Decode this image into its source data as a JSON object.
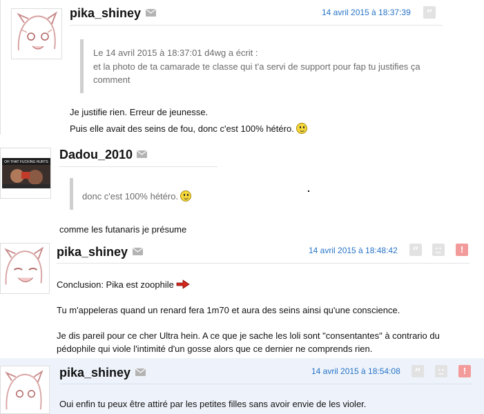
{
  "posts": [
    {
      "username": "pika_shiney",
      "date": "14 avril 2015 à 18:37:39",
      "quote_header": "Le 14 avril 2015 à 18:37:01 d4wg a écrit :",
      "quote_line1": "et la photo de ta camarade te classe qui t'a servi de support pour fap tu justifies ça",
      "quote_line2": "comment",
      "line1": "Je justifie rien. Erreur de jeunesse.",
      "line2": "Puis elle avait des seins de fou, donc c'est 100% hétéro."
    },
    {
      "username": "Dadou_2010",
      "avatar_text": "OH THAT FUCKING HURTS",
      "quote_text": "donc c'est 100% hétéro.",
      "line1": "comme les futanaris je présume"
    },
    {
      "username": "pika_shiney",
      "date": "14 avril 2015 à 18:48:42",
      "line1": "Conclusion: Pika est zoophile",
      "line2": "Tu m'appeleras quand un renard fera 1m70 et aura des seins ainsi qu'une conscience.",
      "line3": "Je dis pareil pour ce cher Ultra hein. A ce que je sache les loli sont \"consentantes\" à contrario du",
      "line4": "pédophile qui viole l'intimité d'un gosse alors que ce dernier ne comprends rien."
    },
    {
      "username": "pika_shiney",
      "date": "14 avril 2015 à 18:54:08",
      "line1": "Oui enfin tu peux être attiré par les petites filles sans avoir envie de les violer."
    }
  ],
  "icons": {
    "quote": "quote-icon",
    "mail": "mail-icon",
    "sad": "sad-face-icon",
    "alert": "alert-icon",
    "smiley": "smiley-icon",
    "arrow": "red-arrow-icon",
    "alert_glyph": "!",
    "quote_glyph": "”"
  },
  "colors": {
    "date_blue": "#2673c7",
    "alert_red": "#f39b9b",
    "highlight_bg": "#eef3fb"
  }
}
